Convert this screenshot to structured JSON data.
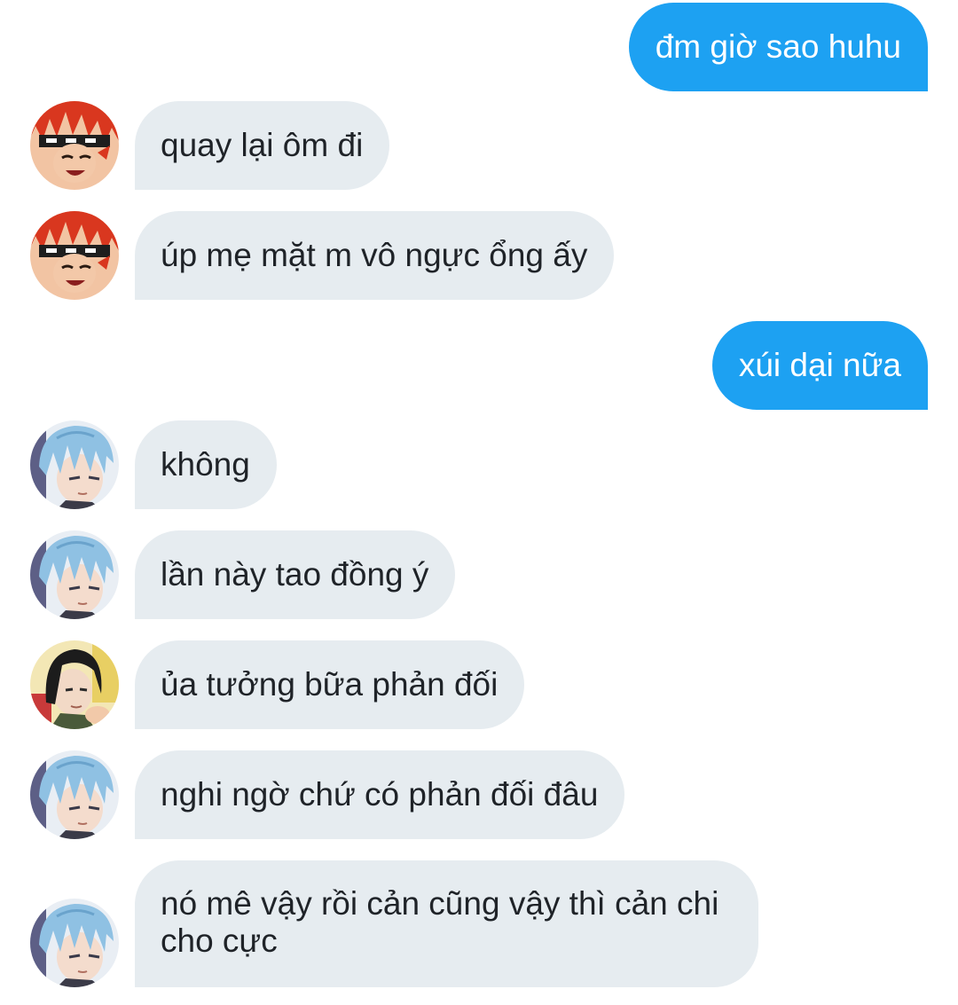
{
  "conversation": {
    "messages": [
      {
        "id": "m1",
        "sender": "self",
        "text": "đm giờ sao huhu"
      },
      {
        "id": "m2",
        "sender": "red-hair-friend",
        "text": "quay lại ôm đi"
      },
      {
        "id": "m3",
        "sender": "red-hair-friend",
        "text": "úp mẹ mặt m vô ngực ổng ấy"
      },
      {
        "id": "m4",
        "sender": "self",
        "text": "xúi dại nữa"
      },
      {
        "id": "m5",
        "sender": "blue-hair-friend",
        "text": "không"
      },
      {
        "id": "m6",
        "sender": "blue-hair-friend",
        "text": "lần này tao đồng ý"
      },
      {
        "id": "m7",
        "sender": "dark-hair-friend",
        "text": "ủa tưởng bữa phản đối"
      },
      {
        "id": "m8",
        "sender": "blue-hair-friend",
        "text": "nghi ngờ chứ có phản đối đâu"
      },
      {
        "id": "m9",
        "sender": "blue-hair-friend",
        "text": "nó mê vậy rồi cản cũng vậy thì cản chi cho cực"
      }
    ]
  },
  "avatars": {
    "red-hair-friend": {
      "icon": "red-hair-avatar-icon",
      "hair_color": "#d9371f",
      "headband_color": "#1e1e1e"
    },
    "blue-hair-friend": {
      "icon": "blue-hair-avatar-icon",
      "hair_color": "#8fc1e3"
    },
    "dark-hair-friend": {
      "icon": "dark-hair-avatar-icon",
      "hair_color": "#1c1c1c"
    }
  },
  "colors": {
    "outgoing_bubble": "#1da1f2",
    "incoming_bubble": "#e6ecf0",
    "incoming_text": "#1f2328",
    "outgoing_text": "#ffffff"
  }
}
